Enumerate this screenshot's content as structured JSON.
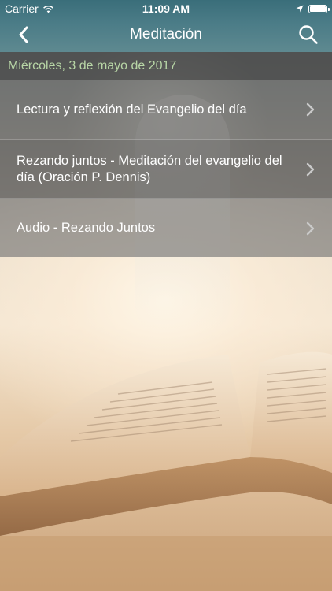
{
  "status_bar": {
    "carrier": "Carrier",
    "time": "11:09 AM",
    "battery_level": 1.0
  },
  "nav": {
    "title": "Meditación",
    "back_icon": "chevron-left-icon",
    "search_icon": "search-icon"
  },
  "date_label": "Miércoles, 3 de mayo de 2017",
  "menu": {
    "items": [
      {
        "label": "Lectura y reflexión del Evangelio del día"
      },
      {
        "label": "Rezando juntos - Meditación del evangelio del día (Oración P. Dennis)"
      },
      {
        "label": "Audio - Rezando Juntos"
      }
    ]
  },
  "colors": {
    "nav_background": "#4b7c87",
    "date_text": "#b8d6a6",
    "date_bar": "#484848",
    "menu_text": "#ffffff"
  }
}
